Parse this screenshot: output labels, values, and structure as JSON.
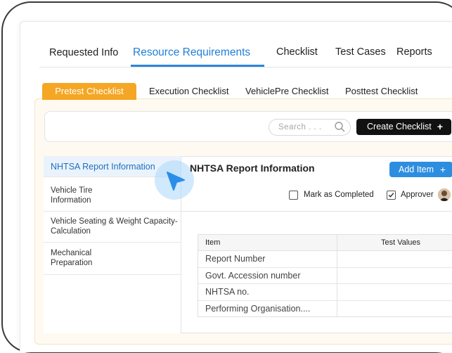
{
  "top_tabs": [
    {
      "label": "Requested Info"
    },
    {
      "label": "Resource Requirements"
    },
    {
      "label": "Checklist"
    },
    {
      "label": "Test Cases"
    },
    {
      "label": "Reports"
    }
  ],
  "sub_tabs": [
    {
      "label": "Pretest Checklist"
    },
    {
      "label": "Execution Checklist"
    },
    {
      "label": "VehiclePre Checklist"
    },
    {
      "label": "Posttest Checklist"
    }
  ],
  "search": {
    "placeholder": "Search . . ."
  },
  "create_button": {
    "label": "Create Checklist",
    "icon": "+"
  },
  "sidebar": {
    "items": [
      {
        "label": "NHTSA Report Information"
      },
      {
        "label": "Vehicle Tire Information"
      },
      {
        "label": "Vehicle Seating & Weight Capacity-Calculation"
      },
      {
        "label": "Mechanical Preparation"
      }
    ]
  },
  "detail": {
    "title": "NHTSA Report Information",
    "add_button": {
      "label": "Add Item",
      "icon": "+"
    },
    "mark_completed": {
      "label": "Mark as Completed",
      "checked": false
    },
    "approver": {
      "label": "Approver",
      "checked": true
    }
  },
  "table": {
    "headers": [
      "Item",
      "Test Values"
    ],
    "rows": [
      {
        "item": "Report Number",
        "value": ""
      },
      {
        "item": "Govt. Accession number",
        "value": ""
      },
      {
        "item": "NHTSA no.",
        "value": ""
      },
      {
        "item": "Performing Organisation....",
        "value": ""
      }
    ]
  },
  "colors": {
    "accent": "#1f7fd6",
    "active_subtab": "#f5a623",
    "create_button": "#111111",
    "add_button": "#2d8ee0"
  }
}
